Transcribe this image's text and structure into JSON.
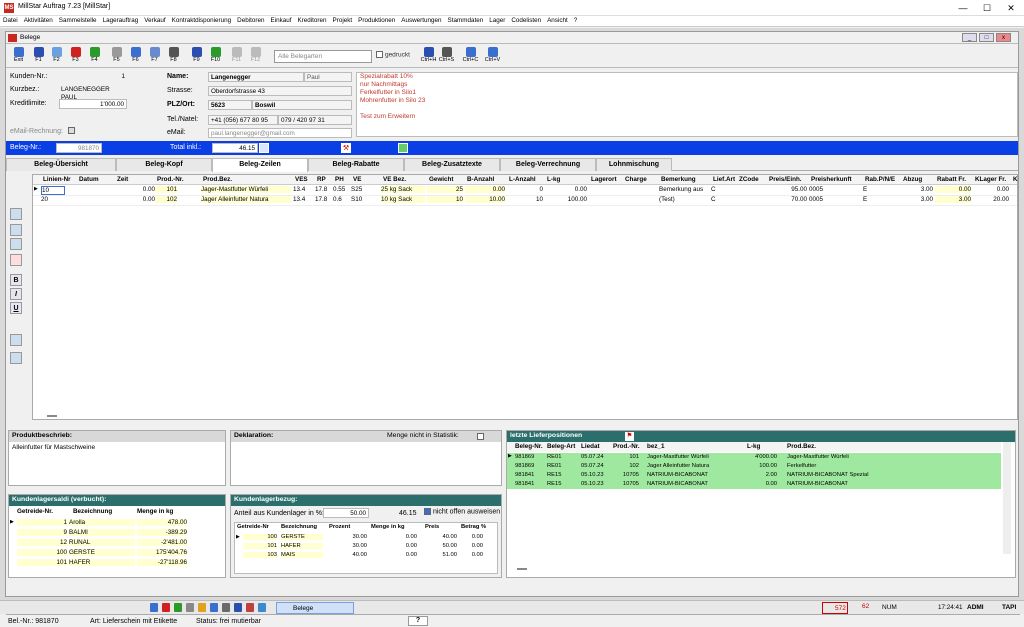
{
  "window": {
    "title": "MillStar Auftrag 7.23 [MillStar]",
    "icon_text": "MS"
  },
  "menu": [
    "Datei",
    "Aktivitäten",
    "Sammelstelle",
    "Lagerauftrag",
    "Verkauf",
    "Kontraktdisponierung",
    "Debitoren",
    "Einkauf",
    "Kreditoren",
    "Projekt",
    "Produktionen",
    "Auswertungen",
    "Stammdaten",
    "Lager",
    "Codelisten",
    "Ansicht",
    "?"
  ],
  "child": {
    "title": "Belege"
  },
  "toolbar": {
    "buttons": [
      {
        "label": "Exit",
        "icon": "exit-icon",
        "color": "#3a6fd0"
      },
      {
        "label": "F1",
        "icon": "help-icon",
        "color": "#2a4fb0"
      },
      {
        "label": "F2",
        "icon": "new-doc-icon",
        "color": "#6aa0e0"
      },
      {
        "label": "F3",
        "icon": "delete-icon",
        "color": "#d02020"
      },
      {
        "label": "F4",
        "icon": "flag-icon",
        "color": "#2a9a2a"
      },
      {
        "label": "F5",
        "icon": "attach-icon",
        "color": "#999"
      },
      {
        "label": "F6",
        "icon": "search-icon",
        "color": "#3a6fd0"
      },
      {
        "label": "F7",
        "icon": "edit-icon",
        "color": "#6a8ad0"
      },
      {
        "label": "F8",
        "icon": "print-icon",
        "color": "#555"
      },
      {
        "label": "F9",
        "icon": "save-icon",
        "color": "#2a4fb0"
      },
      {
        "label": "F10",
        "icon": "check-icon",
        "color": "#2a9a2a"
      },
      {
        "label": "F11",
        "icon": "disabled-icon",
        "color": "#bbb"
      },
      {
        "label": "F12",
        "icon": "disabled-icon",
        "color": "#bbb"
      }
    ],
    "belegarten_placeholder": "Alle Belegarten",
    "gedruckt_label": "gedruckt",
    "right_buttons": [
      {
        "label": "Ctrl+H",
        "icon": "diamond-icon",
        "color": "#2a4fb0"
      },
      {
        "label": "Ctrl+S",
        "icon": "layout-icon",
        "color": "#555"
      },
      {
        "label": "Ctrl+C",
        "icon": "copy-icon",
        "color": "#3a6fd0"
      },
      {
        "label": "Ctrl+V",
        "icon": "paste-icon",
        "color": "#3a6fd0"
      }
    ]
  },
  "customer": {
    "kunden_nr_label": "Kunden-Nr.:",
    "kunden_nr": "1",
    "kurzbez_label": "Kurzbez.:",
    "kurzbez": "LANGENEGGER PAUL",
    "kreditlimite_label": "Kreditlimite:",
    "kreditlimite": "1'000.00",
    "email_rechnung_label": "eMail-Rechnung:",
    "name_label": "Name:",
    "name": "Langenegger",
    "vorname": "Paul",
    "strasse_label": "Strasse:",
    "strasse": "Oberdorfstrasse 43",
    "plz_label": "PLZ/Ort:",
    "plz": "5623",
    "ort": "Boswil",
    "tel_label": "Tel./Natel:",
    "tel": "+41 (056) 677 80 95",
    "natel": "079 / 420 97 31",
    "email_label": "eMail:",
    "email": "paul.langenegger@gmail.com",
    "notes": [
      "Spezialrabatt 10%",
      "nur Nachmittags",
      "Ferkelfutter in Silo1",
      "Mohrenfutter in Silo 23",
      "",
      "Test zum Erweitern"
    ]
  },
  "bluebar": {
    "beleg_nr_label": "Beleg-Nr.:",
    "beleg_nr": "981870",
    "total_label": "Total inkl.:",
    "total": "46.15"
  },
  "tabs": [
    "Beleg-Übersicht",
    "Beleg-Kopf",
    "Beleg-Zeilen",
    "Beleg-Rabatte",
    "Beleg-Zusatztexte",
    "Beleg-Verrechnung",
    "Lohnmischung"
  ],
  "active_tab": "Beleg-Zeilen",
  "lines": {
    "headers": [
      "Linien-Nr",
      "Datum",
      "Zeit",
      "Prod.-Nr.",
      "Prod.Bez.",
      "VES",
      "RP",
      "PH",
      "VE",
      "VE Bez.",
      "Gewicht",
      "B-Anzahl",
      "L-Anzahl",
      "L-kg",
      "Lagerort",
      "Charge",
      "Bemerkung",
      "Lief.Art",
      "ZCode",
      "Preis/Einh.",
      "Preisherkunft",
      "Rab.P/N/E",
      "Abzug",
      "Rabatt Fr.",
      "KLager Fr.",
      "K"
    ],
    "rows": [
      [
        "10",
        "",
        "0.00",
        "101",
        "Jager-Mastfutter Würfeli",
        "13.4",
        "17.8",
        "0.55",
        "S25",
        "25 kg Sack",
        "25",
        "0.00",
        "0",
        "0.00",
        "",
        "",
        "Bemerkung aus",
        "C",
        "",
        "95.00",
        "0005",
        "E",
        "3.00",
        "0.00",
        "0.00"
      ],
      [
        "20",
        "",
        "0.00",
        "102",
        "Jager Alleinfutter Natura",
        "13.4",
        "17.8",
        "0.6",
        "S10",
        "10 kg Sack",
        "10",
        "10.00",
        "10",
        "100.00",
        "",
        "",
        "(Test)",
        "C",
        "",
        "70.00",
        "0005",
        "E",
        "3.00",
        "3.00",
        "20.00"
      ]
    ]
  },
  "side_buttons": [
    "insert-row-icon",
    "insert-row-icon",
    "add-row-icon",
    "delete-row-icon",
    "B",
    "I",
    "U",
    "list-icon",
    "grid-icon"
  ],
  "produkt": {
    "title": "Produktbeschrieb:",
    "text": "Alleinfutter für Mastschweine"
  },
  "deklaration": {
    "title": "Deklaration:",
    "menge_label": "Menge nicht in Statistik:"
  },
  "lieferpos": {
    "title": "letzte Lieferpositionen",
    "headers": [
      "Beleg-Nr.",
      "Beleg-Art",
      "Liedat",
      "Prod.-Nr.",
      "bez_1",
      "L-kg",
      "Prod.Bez."
    ],
    "rows": [
      [
        "981869",
        "RE01",
        "05.07.24",
        "101",
        "Jager-Mastfutter Würfeli",
        "4'000.00",
        "Jager-Mastfutter Würfeli"
      ],
      [
        "981869",
        "RE01",
        "05.07.24",
        "102",
        "Jager Alleinfutter Natura",
        "100.00",
        "Ferkelfutter"
      ],
      [
        "981841",
        "RE15",
        "05.10.23",
        "10705",
        "NATRIUM-BICABONAT",
        "2.00",
        "NATRIUM-BICABONAT Spezial"
      ],
      [
        "981841",
        "RE15",
        "05.10.23",
        "10705",
        "NATRIUM-BICABONAT",
        "0.00",
        "NATRIUM-BICABONAT"
      ]
    ]
  },
  "saldi": {
    "title": "Kundenlagersaldi (verbucht):",
    "headers": [
      "Getreide-Nr.",
      "Bezeichnung",
      "Menge in kg"
    ],
    "rows": [
      [
        "1",
        "Arolla",
        "478.00"
      ],
      [
        "9",
        "BALMI",
        "-389.29"
      ],
      [
        "12",
        "RUNAL",
        "-2'481.00"
      ],
      [
        "100",
        "GERSTE",
        "175'404.76"
      ],
      [
        "101",
        "HAFER",
        "-27'118.96"
      ]
    ]
  },
  "bezug": {
    "title": "Kundenlagerbezug:",
    "anteil_label": "Anteil aus Kundenlager in %:",
    "anteil": "50.00",
    "wert": "46.15",
    "nicht_offen_label": "nicht offen ausweisen",
    "headers": [
      "Getreide-Nr",
      "Bezeichnung",
      "Prozent",
      "Menge in kg",
      "Preis",
      "Betrag %"
    ],
    "rows": [
      [
        "100",
        "GERSTE",
        "30.00",
        "0.00",
        "40.00",
        "0.00"
      ],
      [
        "101",
        "HAFER",
        "30.00",
        "0.00",
        "50.00",
        "0.00"
      ],
      [
        "103",
        "MAIS",
        "40.00",
        "0.00",
        "51.00",
        "0.00"
      ]
    ]
  },
  "status": {
    "beleg": "Bel.-Nr.: 981870",
    "art": "Art: Lieferschein mit Etikette",
    "status": "Status: frei mutierbar",
    "help": "?"
  },
  "taskbar": {
    "task": "Belege",
    "count1": "572",
    "count2": "62",
    "num": "NUM",
    "time": "17:24:41",
    "user": "ADMI",
    "tap": "TAPI"
  }
}
